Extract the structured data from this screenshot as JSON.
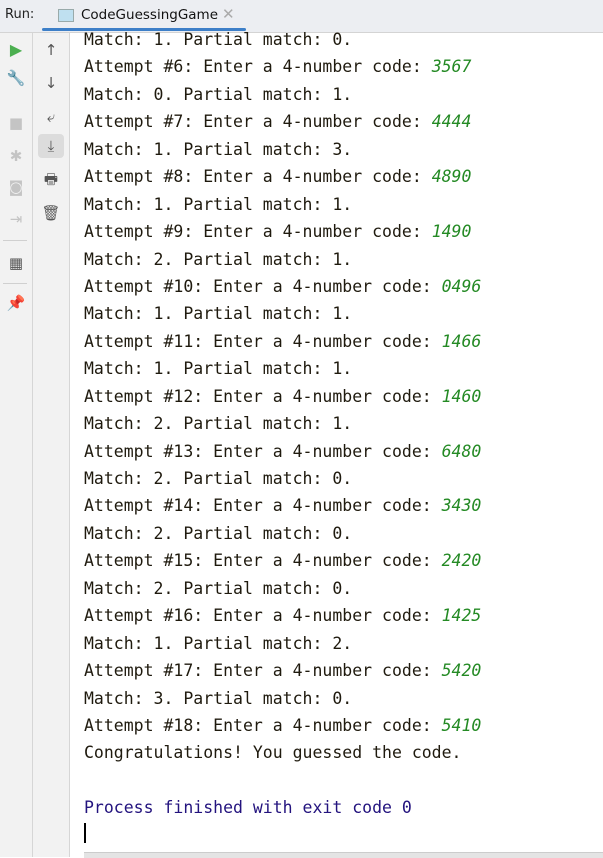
{
  "header": {
    "run_label": "Run:",
    "tab_title": "CodeGuessingGame"
  },
  "colors": {
    "input": "#248a24",
    "process": "#23137e",
    "accent": "#3d7fc8",
    "run": "#4caf50"
  },
  "toolbar_left": [
    "run-icon",
    "wrench-icon",
    "stop-icon",
    "debug-icon",
    "camera-icon",
    "login-icon",
    "layout-icon",
    "pin-icon"
  ],
  "toolbar_right": [
    "arrow-up-icon",
    "arrow-down-icon",
    "soft-wrap-icon",
    "scroll-to-end-icon",
    "print-icon",
    "trash-icon"
  ],
  "console": {
    "lines": [
      {
        "text": "Match: 1. Partial match: 0."
      },
      {
        "text": "Attempt #6: Enter a 4-number code: ",
        "input": "3567"
      },
      {
        "text": "Match: 0. Partial match: 1."
      },
      {
        "text": "Attempt #7: Enter a 4-number code: ",
        "input": "4444"
      },
      {
        "text": "Match: 1. Partial match: 3."
      },
      {
        "text": "Attempt #8: Enter a 4-number code: ",
        "input": "4890"
      },
      {
        "text": "Match: 1. Partial match: 1."
      },
      {
        "text": "Attempt #9: Enter a 4-number code: ",
        "input": "1490"
      },
      {
        "text": "Match: 2. Partial match: 1."
      },
      {
        "text": "Attempt #10: Enter a 4-number code: ",
        "input": "0496"
      },
      {
        "text": "Match: 1. Partial match: 1."
      },
      {
        "text": "Attempt #11: Enter a 4-number code: ",
        "input": "1466"
      },
      {
        "text": "Match: 1. Partial match: 1."
      },
      {
        "text": "Attempt #12: Enter a 4-number code: ",
        "input": "1460"
      },
      {
        "text": "Match: 2. Partial match: 1."
      },
      {
        "text": "Attempt #13: Enter a 4-number code: ",
        "input": "6480"
      },
      {
        "text": "Match: 2. Partial match: 0."
      },
      {
        "text": "Attempt #14: Enter a 4-number code: ",
        "input": "3430"
      },
      {
        "text": "Match: 2. Partial match: 0."
      },
      {
        "text": "Attempt #15: Enter a 4-number code: ",
        "input": "2420"
      },
      {
        "text": "Match: 2. Partial match: 0."
      },
      {
        "text": "Attempt #16: Enter a 4-number code: ",
        "input": "1425"
      },
      {
        "text": "Match: 1. Partial match: 2."
      },
      {
        "text": "Attempt #17: Enter a 4-number code: ",
        "input": "5420"
      },
      {
        "text": "Match: 3. Partial match: 0."
      },
      {
        "text": "Attempt #18: Enter a 4-number code: ",
        "input": "5410"
      },
      {
        "text": "Congratulations! You guessed the code."
      },
      {
        "text": ""
      },
      {
        "text": "Process finished with exit code 0",
        "process": true
      }
    ]
  }
}
